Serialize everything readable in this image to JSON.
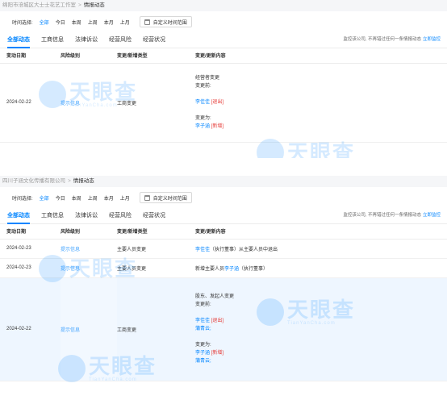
{
  "panel1": {
    "breadcrumb": {
      "company": "绵阳市涪城区大士士花艺工作室",
      "current": "情报动态"
    },
    "filter": {
      "label": "时间选择:",
      "options": [
        "全部",
        "今日",
        "本周",
        "上周",
        "本月",
        "上月"
      ],
      "custom": "自定义时间范围"
    },
    "tabs": [
      "全部动态",
      "工商信息",
      "法律诉讼",
      "经营风险",
      "经营状况"
    ],
    "note": {
      "text": "监控该公司, 不再错过任何一条情报动态",
      "link": "立即监控"
    },
    "headers": [
      "变动日期",
      "风险级别",
      "变更/新增类型",
      "变更/更新内容"
    ],
    "row": {
      "date": "2024-02-22",
      "risk": "提示信息",
      "type": "工商变更",
      "content": [
        "经营者变更",
        "变更前:",
        "李佳佳 [退出]",
        "变更为:",
        "李子涵 [新增]"
      ]
    },
    "watermark": {
      "big": "天眼查",
      "small": "TianYanCha.com"
    }
  },
  "panel2": {
    "breadcrumb": {
      "company": "四川子涵文化传播有限公司",
      "current": "情报动态"
    },
    "filter": {
      "label": "时间选择:",
      "options": [
        "全部",
        "今日",
        "本周",
        "上周",
        "本月",
        "上月"
      ],
      "custom": "自定义时间范围"
    },
    "tabs": [
      "全部动态",
      "工商信息",
      "法律诉讼",
      "经营风险",
      "经营状况"
    ],
    "note": {
      "text": "监控该公司, 不再错过任何一条情报动态",
      "link": "立即监控"
    },
    "headers": [
      "变动日期",
      "风险级别",
      "变更/新增类型",
      "变更/更新内容"
    ],
    "rows": [
      {
        "date": "2024-02-23",
        "risk": "提示信息",
        "type": "主要人员变更",
        "name": "李佳佳",
        "text": "（执行董事）从主要人员中退出"
      },
      {
        "date": "2024-02-23",
        "risk": "提示信息",
        "type": "主要人员变更",
        "prefix": "新增主要人员",
        "name": "李子涵",
        "text": "（执行董事）"
      }
    ],
    "row3": {
      "date": "2024-02-22",
      "risk": "提示信息",
      "type": "工商变更",
      "content": [
        "股东、发起人变更",
        "变更前:",
        "李佳佳 [退出]",
        "蒲青云;",
        "变更为:",
        "李子涵 [新增]",
        "蒲青云;"
      ]
    },
    "watermark": {
      "big": "天眼查",
      "small": "TianYanCha.com"
    }
  }
}
